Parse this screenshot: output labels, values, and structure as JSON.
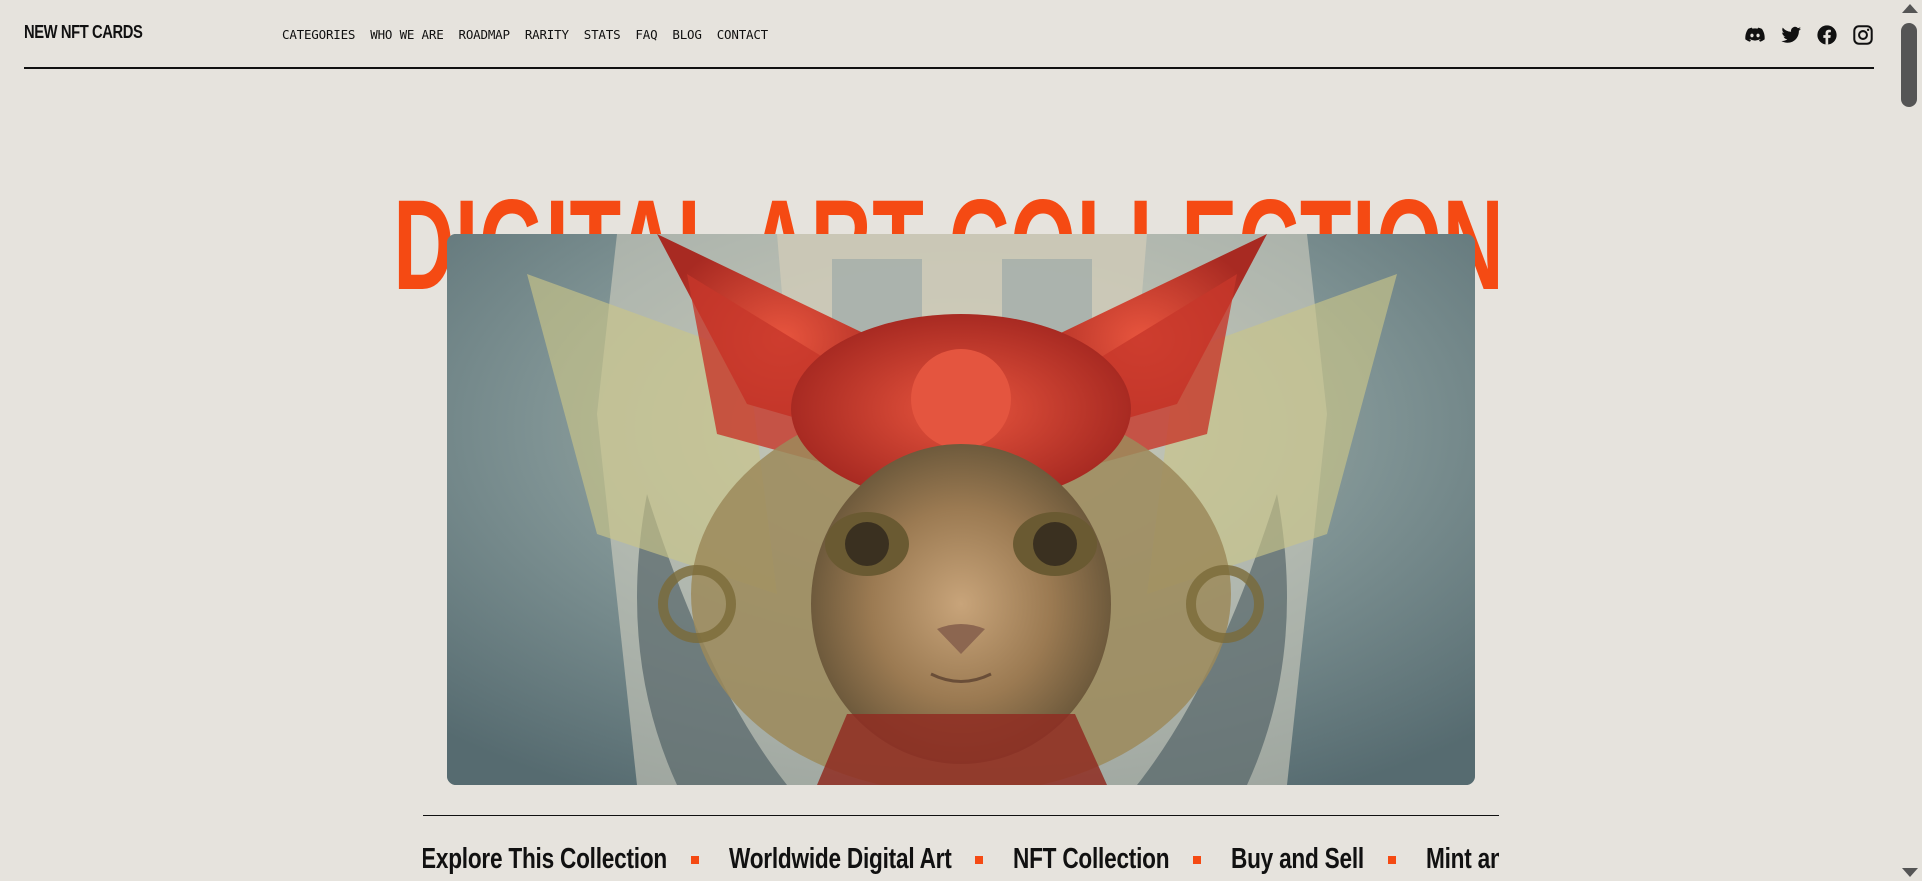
{
  "header": {
    "logo": "NEW NFT CARDS",
    "nav": [
      {
        "label": "CATEGORIES",
        "name": "nav-categories"
      },
      {
        "label": "WHO WE ARE",
        "name": "nav-who-we-are"
      },
      {
        "label": "ROADMAP",
        "name": "nav-roadmap"
      },
      {
        "label": "RARITY",
        "name": "nav-rarity"
      },
      {
        "label": "STATS",
        "name": "nav-stats"
      },
      {
        "label": "FAQ",
        "name": "nav-faq"
      },
      {
        "label": "BLOG",
        "name": "nav-blog"
      },
      {
        "label": "CONTACT",
        "name": "nav-contact"
      }
    ],
    "social": [
      "discord-icon",
      "twitter-icon",
      "facebook-icon",
      "instagram-icon"
    ]
  },
  "hero": {
    "title": "DIGITAL ART COLLECTION",
    "image_icon": "fox-portrait-artwork"
  },
  "marquee": {
    "items": [
      "Explore This Collection",
      "Worldwide Digital Art",
      "NFT Collection",
      "Buy and Sell",
      "Mint and Create"
    ]
  },
  "colors": {
    "background": "#e6e3dd",
    "accent": "#f54a13",
    "text": "#111111"
  }
}
